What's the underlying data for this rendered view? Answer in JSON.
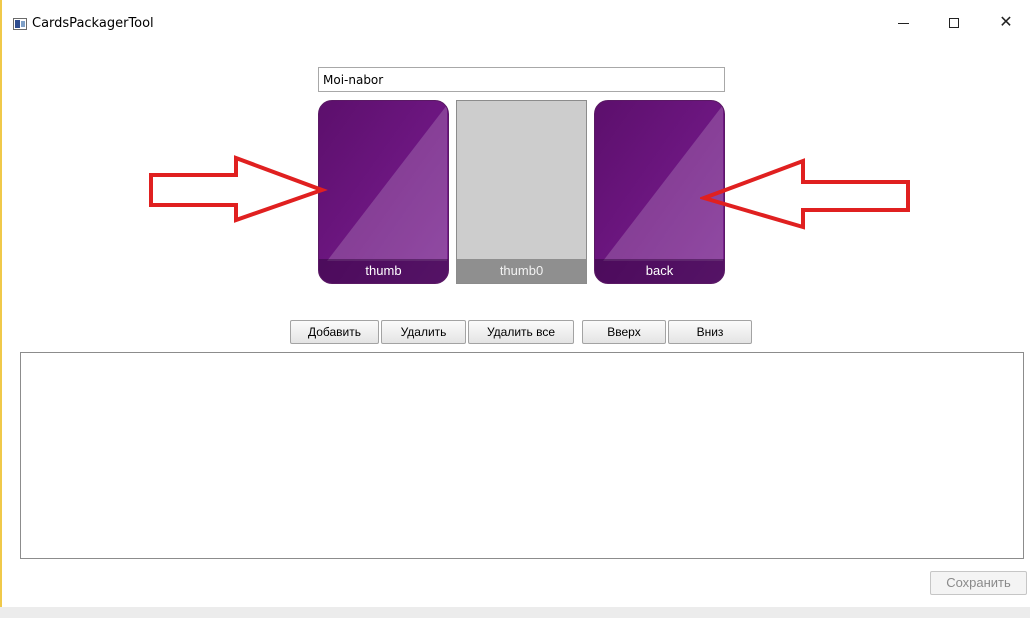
{
  "window": {
    "title": "CardsPackagerTool",
    "icon": "app-window-icon",
    "controls": {
      "minimize": "minimize-icon",
      "maximize": "maximize-icon",
      "close": "close-icon",
      "close_glyph": "✕"
    }
  },
  "name_input": {
    "value": "Moi-nabor"
  },
  "cards": [
    {
      "label": "thumb",
      "style": "image"
    },
    {
      "label": "thumb0",
      "style": "empty"
    },
    {
      "label": "back",
      "style": "image"
    }
  ],
  "annotations": {
    "arrow_color": "#e02020",
    "count": 2
  },
  "buttons": {
    "add": "Добавить",
    "delete": "Удалить",
    "delete_all": "Удалить все",
    "up": "Вверх",
    "down": "Вниз"
  },
  "list": {
    "items": []
  },
  "save_button": {
    "label": "Сохранить",
    "enabled": false
  },
  "colors": {
    "card_purple": "#6a157d",
    "card_placeholder": "#cdcdcd"
  }
}
